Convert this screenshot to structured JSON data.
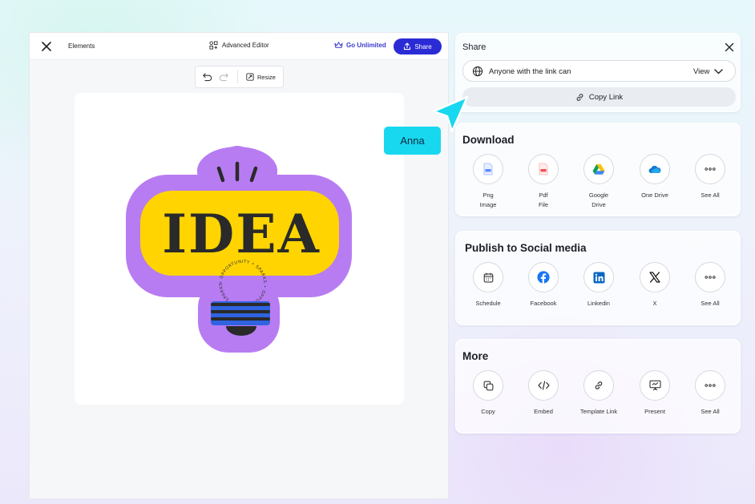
{
  "editor": {
    "elements_label": "Elements",
    "advanced_editor_label": "Advanced Editor",
    "go_unlimited_label": "Go Unlimited",
    "share_label": "Share",
    "resize_label": "Resize"
  },
  "artwork": {
    "headline": "IDEA",
    "circle_text": "• OPPORTUNITY • SPARKS • OPPORTUNITY • SPARKS"
  },
  "share_panel": {
    "title": "Share",
    "access_text": "Anyone with the link can",
    "permission": "View",
    "copy_link_label": "Copy Link"
  },
  "download": {
    "title": "Download",
    "items": [
      {
        "label": "Png\nImage",
        "icon": "png-file-icon"
      },
      {
        "label": "Pdf\nFile",
        "icon": "pdf-file-icon"
      },
      {
        "label": "Google\nDrive",
        "icon": "google-drive-icon"
      },
      {
        "label": "One Drive",
        "icon": "onedrive-icon"
      },
      {
        "label": "See All",
        "icon": "more-dots-icon"
      }
    ]
  },
  "social": {
    "title": "Publish to Social media",
    "items": [
      {
        "label": "Schedule",
        "icon": "calendar-icon"
      },
      {
        "label": "Facebook",
        "icon": "facebook-icon"
      },
      {
        "label": "Linkedin",
        "icon": "linkedin-icon"
      },
      {
        "label": "X",
        "icon": "x-logo-icon"
      },
      {
        "label": "See All",
        "icon": "more-dots-icon"
      }
    ]
  },
  "more": {
    "title": "More",
    "items": [
      {
        "label": "Copy",
        "icon": "copy-icon"
      },
      {
        "label": "Embed",
        "icon": "code-icon"
      },
      {
        "label": "Template Link",
        "icon": "link-icon"
      },
      {
        "label": "Present",
        "icon": "presentation-icon"
      },
      {
        "label": "See All",
        "icon": "more-dots-icon"
      }
    ]
  },
  "cursor": {
    "user_name": "Anna",
    "color": "#18d8f0"
  },
  "colors": {
    "primary_button": "#2b2bd6",
    "idea_purple": "#b77cf2",
    "idea_yellow": "#ffd400",
    "idea_blue": "#2f63e0"
  }
}
